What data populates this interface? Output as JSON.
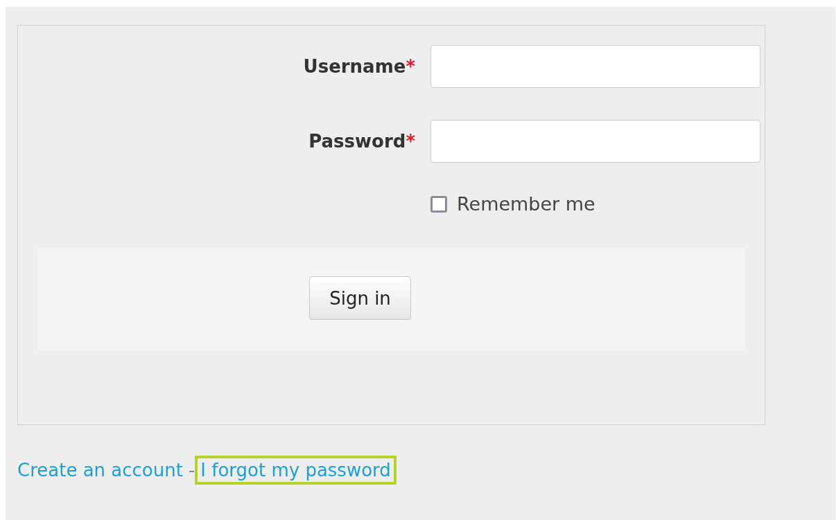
{
  "form": {
    "fields": [
      {
        "label": "Username",
        "required_mark": "*"
      },
      {
        "label": "Password",
        "required_mark": "*"
      }
    ],
    "remember": {
      "label": "Remember me",
      "checked": false
    },
    "submit": "Sign in"
  },
  "links": {
    "items": [
      {
        "label": "Create an account",
        "highlighted": false
      },
      {
        "label": "I forgot my password",
        "highlighted": true
      }
    ],
    "separator": "-"
  }
}
